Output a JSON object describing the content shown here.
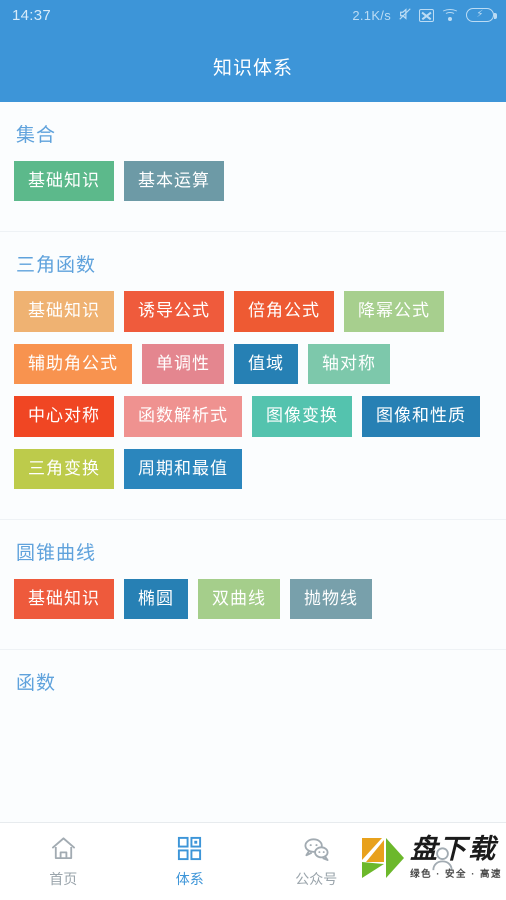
{
  "status_bar": {
    "clock": "14:37",
    "net_speed": "2.1K/s",
    "icons": [
      "mute-icon",
      "no-sim-icon",
      "wifi-icon",
      "battery-charging-icon"
    ],
    "battery_glyph": "⚡",
    "mute_glyph": "🔇",
    "background": "#3d95d8",
    "foreground": "#bcdcf4"
  },
  "title_bar": {
    "title": "知识体系",
    "background": "#3d95d8",
    "text_color": "#ffffff"
  },
  "theme": {
    "page_background": "#fbfdfe",
    "section_title_color": "#5fa2dc",
    "divider": "#eef2f5",
    "nav_active": "#3d95d8",
    "nav_inactive": "#9aa4ab"
  },
  "sections": [
    {
      "title": "集合",
      "tags": [
        {
          "label": "基础知识",
          "color": "#5cb98b"
        },
        {
          "label": "基本运算",
          "color": "#6d9aa6"
        }
      ]
    },
    {
      "title": "三角函数",
      "tags": [
        {
          "label": "基础知识",
          "color": "#efb272"
        },
        {
          "label": "诱导公式",
          "color": "#ef5b3c"
        },
        {
          "label": "倍角公式",
          "color": "#ee5a33"
        },
        {
          "label": "降幂公式",
          "color": "#a7cf8e"
        },
        {
          "label": "辅助角公式",
          "color": "#f8934f"
        },
        {
          "label": "单调性",
          "color": "#e4868f"
        },
        {
          "label": "值域",
          "color": "#2680b4"
        },
        {
          "label": "轴对称",
          "color": "#7dc8ab"
        },
        {
          "label": "中心对称",
          "color": "#f04623"
        },
        {
          "label": "函数解析式",
          "color": "#ef9290"
        },
        {
          "label": "图像变换",
          "color": "#54c3ae"
        },
        {
          "label": "图像和性质",
          "color": "#2780b4"
        },
        {
          "label": "三角变换",
          "color": "#bdcb4b"
        },
        {
          "label": "周期和最值",
          "color": "#2b86bd"
        }
      ]
    },
    {
      "title": "圆锥曲线",
      "tags": [
        {
          "label": "基础知识",
          "color": "#ee5a3c"
        },
        {
          "label": "椭圆",
          "color": "#2780b4"
        },
        {
          "label": "双曲线",
          "color": "#a5ce8b"
        },
        {
          "label": "抛物线",
          "color": "#78a0ab"
        }
      ]
    },
    {
      "title": "函数",
      "tags": []
    }
  ],
  "bottom_nav": {
    "items": [
      {
        "label": "首页",
        "icon": "home-icon",
        "active": false
      },
      {
        "label": "体系",
        "icon": "grid-icon",
        "active": true
      },
      {
        "label": "公众号",
        "icon": "chat-bubbles-icon",
        "active": false
      },
      {
        "label": "",
        "icon": "person-icon",
        "active": false
      }
    ]
  },
  "watermark": {
    "main_text": "盘下载",
    "sub_text": "绿色 · 安全 · 高速",
    "mark_letter": "K",
    "green": "#6cb82b",
    "orange": "#e8a11c"
  }
}
